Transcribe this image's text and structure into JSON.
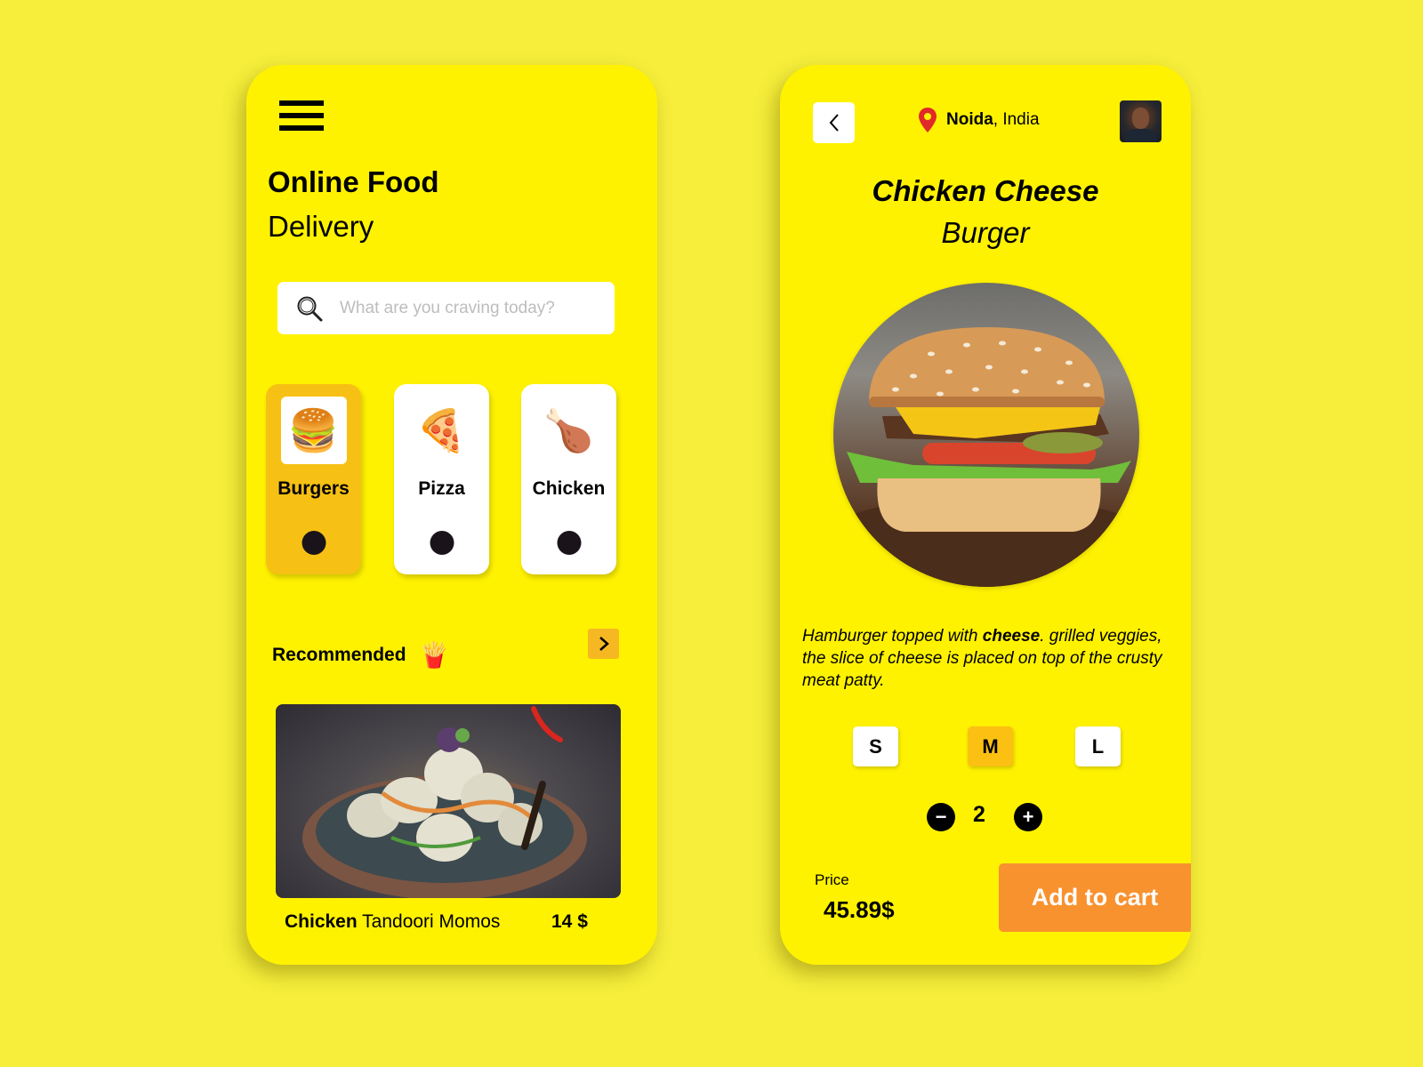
{
  "home": {
    "title_bold": "Online Food",
    "title_light": "Delivery",
    "search": {
      "placeholder": "What are you craving today?",
      "value": ""
    },
    "categories": [
      {
        "label": "Burgers",
        "icon": "🍔",
        "active": true
      },
      {
        "label": "Pizza",
        "icon": "🍕",
        "active": false
      },
      {
        "label": "Chicken",
        "icon": "🍗",
        "active": false
      }
    ],
    "recommended": {
      "title": "Recommended",
      "icon": "🍟",
      "item": {
        "name_bold": "Chicken",
        "name_rest": " Tandoori Momos",
        "price": "14 $"
      }
    }
  },
  "detail": {
    "location": {
      "city": "Noida",
      "country": ", India"
    },
    "title_line1": "Chicken Cheese",
    "title_line2": "Burger",
    "description": {
      "part1": "Hamburger topped with ",
      "bold": "cheese",
      "part2": ". grilled veggies, the slice of cheese is placed on top of the crusty meat patty."
    },
    "sizes": [
      {
        "label": "S",
        "active": false
      },
      {
        "label": "M",
        "active": true
      },
      {
        "label": "L",
        "active": false
      }
    ],
    "quantity": "2",
    "minus_label": "−",
    "plus_label": "+",
    "price_label": "Price",
    "price": "45.89$",
    "add_to_cart": "Add to cart"
  },
  "colors": {
    "background": "#f6ee3a",
    "phone": "#fff200",
    "active_card": "#f6c114",
    "cart_button": "#f8922f",
    "pin": "#e02a2a"
  }
}
